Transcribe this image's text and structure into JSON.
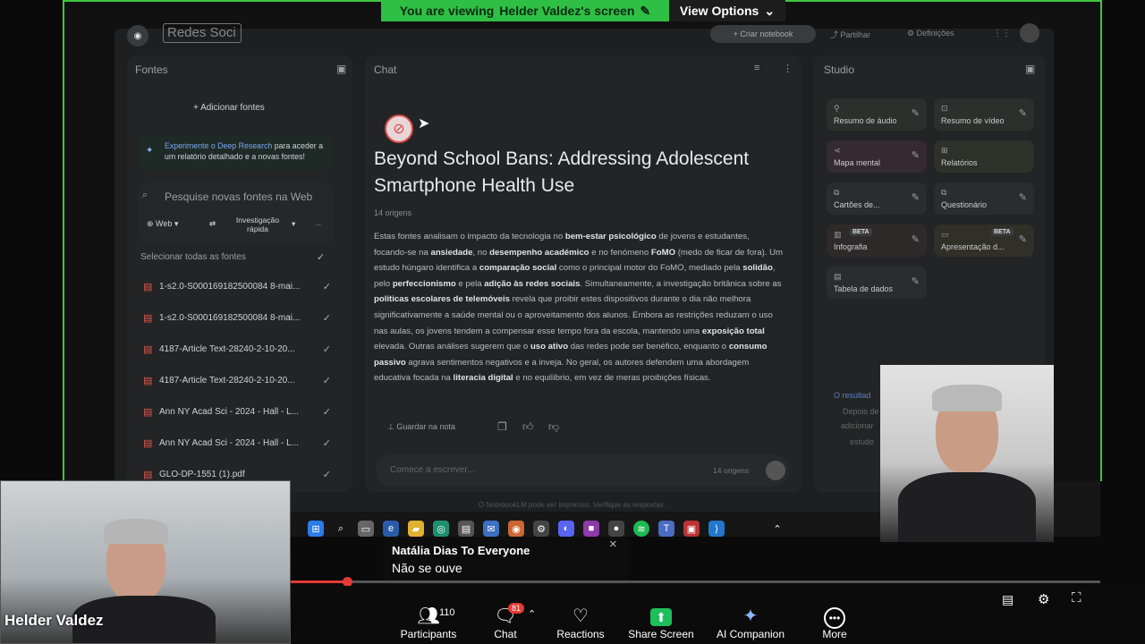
{
  "banner": {
    "viewing_text": "You are viewing",
    "presenter": "Helder Valdez's screen",
    "view_options": "View Options"
  },
  "notebook": {
    "search_box_value": "Redes Soci",
    "top_buttons": {
      "create": "+ Criar notebook",
      "share": "Partilhar",
      "settings": "Definições"
    },
    "sources": {
      "title": "Fontes",
      "add_label": "Adicionar fontes",
      "promo_link": "Experimente o Deep Research",
      "promo_text": "para aceder a um relatório detalhado e a novas fontes!",
      "search_placeholder": "Pesquise novas fontes na Web",
      "web_chip": "Web",
      "research_chip": "Investigação rápida",
      "select_all": "Selecionar todas as fontes",
      "items": [
        "1-s2.0-S000169182500084 8-mai...",
        "1-s2.0-S000169182500084 8-mai...",
        "4187-Article Text-28240-2-10-20...",
        "4187-Article Text-28240-2-10-20...",
        "Ann NY Acad Sci - 2024 - Hall - L...",
        "Ann NY Acad Sci - 2024 - Hall - L...",
        "GLO-DP-1551 (1).pdf"
      ]
    },
    "chat": {
      "title": "Chat",
      "heading": "Beyond School Bans: Addressing Adolescent Smartphone Health Use",
      "origins": "14 origens",
      "save_note": "Guardar na nota",
      "input_placeholder": "Comece a escrever...",
      "input_origins": "14 origens",
      "disclaimer": "O NotebookLM pode ser impreciso. Verifique as respostas."
    },
    "studio": {
      "title": "Studio",
      "cards": [
        "Resumo de áudio",
        "Resumo de vídeo",
        "Mapa mental",
        "Relatórios",
        "Cartões de...",
        "Questionário",
        "Infografia",
        "Apresentação d...",
        "Tabela de dados"
      ],
      "beta": "BETA",
      "footer_partial": [
        "O resultad",
        "Depois de",
        "adicionar",
        "estudo"
      ]
    }
  },
  "summary_parts": [
    {
      "t": "Estas fontes analisam o impacto da tecnologia no "
    },
    {
      "b": "bem-estar psicológico"
    },
    {
      "t": " de jovens e estudantes, focando-se na "
    },
    {
      "b": "ansiedade"
    },
    {
      "t": ", no "
    },
    {
      "b": "desempenho académico"
    },
    {
      "t": " e no fenómeno "
    },
    {
      "b": "FoMO"
    },
    {
      "t": " (medo de ficar de fora). Um estudo húngaro identifica a "
    },
    {
      "b": "comparação social"
    },
    {
      "t": " como o principal motor do FoMO, mediado pela "
    },
    {
      "b": "solidão"
    },
    {
      "t": ", pelo "
    },
    {
      "b": "perfeccionismo"
    },
    {
      "t": " e pela "
    },
    {
      "b": "adição às redes sociais"
    },
    {
      "t": ". Simultaneamente, a investigação britânica sobre as "
    },
    {
      "b": "políticas escolares de telemóveis"
    },
    {
      "t": " revela que proibir estes dispositivos durante o dia não melhora significativamente a saúde mental ou o aproveitamento dos alunos. Embora as restrições reduzam o uso nas aulas, os jovens tendem a compensar esse tempo fora da escola, mantendo uma "
    },
    {
      "b": "exposição total"
    },
    {
      "t": " elevada. Outras análises sugerem que o "
    },
    {
      "b": "uso ativo"
    },
    {
      "t": " das redes pode ser benéfico, enquanto o "
    },
    {
      "b": "consumo passivo"
    },
    {
      "t": " agrava sentimentos negativos e a inveja. No geral, os autores defendem uma abordagem educativa focada na "
    },
    {
      "b": "literacia digital"
    },
    {
      "t": " e no equilíbrio, em vez de meras proibições físicas."
    }
  ],
  "chat_toast": {
    "sender": "Natália Dias To Everyone",
    "message": "Não se ouve"
  },
  "self_video": {
    "name": "Helder Valdez"
  },
  "toolbar": {
    "participants": {
      "label": "Participants",
      "count": "110"
    },
    "chat": {
      "label": "Chat",
      "badge": "81"
    },
    "reactions": {
      "label": "Reactions"
    },
    "share": {
      "label": "Share Screen"
    },
    "companion": {
      "label": "AI Companion"
    },
    "more": {
      "label": "More"
    }
  },
  "playback_progress": 0.07,
  "colors": {
    "share_border": "#3ec73e",
    "banner": "#2fbf45",
    "accent_red": "#e53935",
    "share_button": "#1dbf5a"
  }
}
